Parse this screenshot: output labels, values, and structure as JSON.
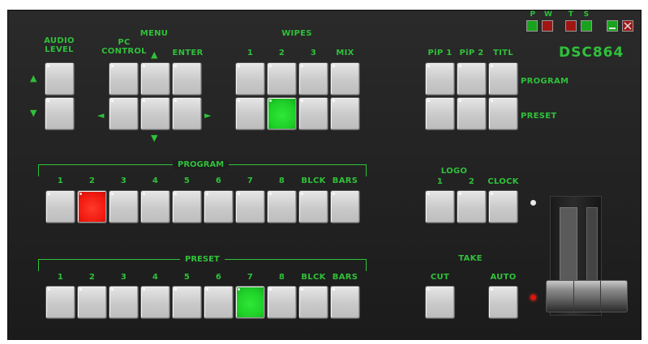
{
  "brand": "DSC864",
  "status": {
    "labels": [
      "P",
      "W",
      "T",
      "S"
    ],
    "colors": {
      "green": "#1aa21f",
      "red": "#a01612",
      "accent": "#2fc13a"
    }
  },
  "window": {
    "minimize_icon": "minimize-icon",
    "close_icon": "close-icon"
  },
  "audio": {
    "title": "AUDIO\nLEVEL"
  },
  "menu": {
    "title": "MENU",
    "pc_label": "PC\nCONTROL",
    "enter_label": "ENTER"
  },
  "wipes": {
    "title": "WIPES",
    "labels": [
      "1",
      "2",
      "3",
      "MIX"
    ],
    "active_index": 1
  },
  "pip": {
    "labels": [
      "PiP 1",
      "PiP 2",
      "TITL"
    ],
    "row_program": "PROGRAM",
    "row_preset": "PRESET"
  },
  "program": {
    "title": "PROGRAM",
    "labels": [
      "1",
      "2",
      "3",
      "4",
      "5",
      "6",
      "7",
      "8",
      "BLCK",
      "BARS"
    ],
    "active_index": 1
  },
  "preset": {
    "title": "PRESET",
    "labels": [
      "1",
      "2",
      "3",
      "4",
      "5",
      "6",
      "7",
      "8",
      "BLCK",
      "BARS"
    ],
    "active_index": 6
  },
  "logo": {
    "title": "LOGO",
    "labels": [
      "1",
      "2",
      "CLOCK"
    ]
  },
  "take": {
    "title": "TAKE",
    "cut_label": "CUT",
    "auto_label": "AUTO"
  },
  "arrows": {
    "up": "▲",
    "down": "▼",
    "left": "◄",
    "right": "►"
  }
}
